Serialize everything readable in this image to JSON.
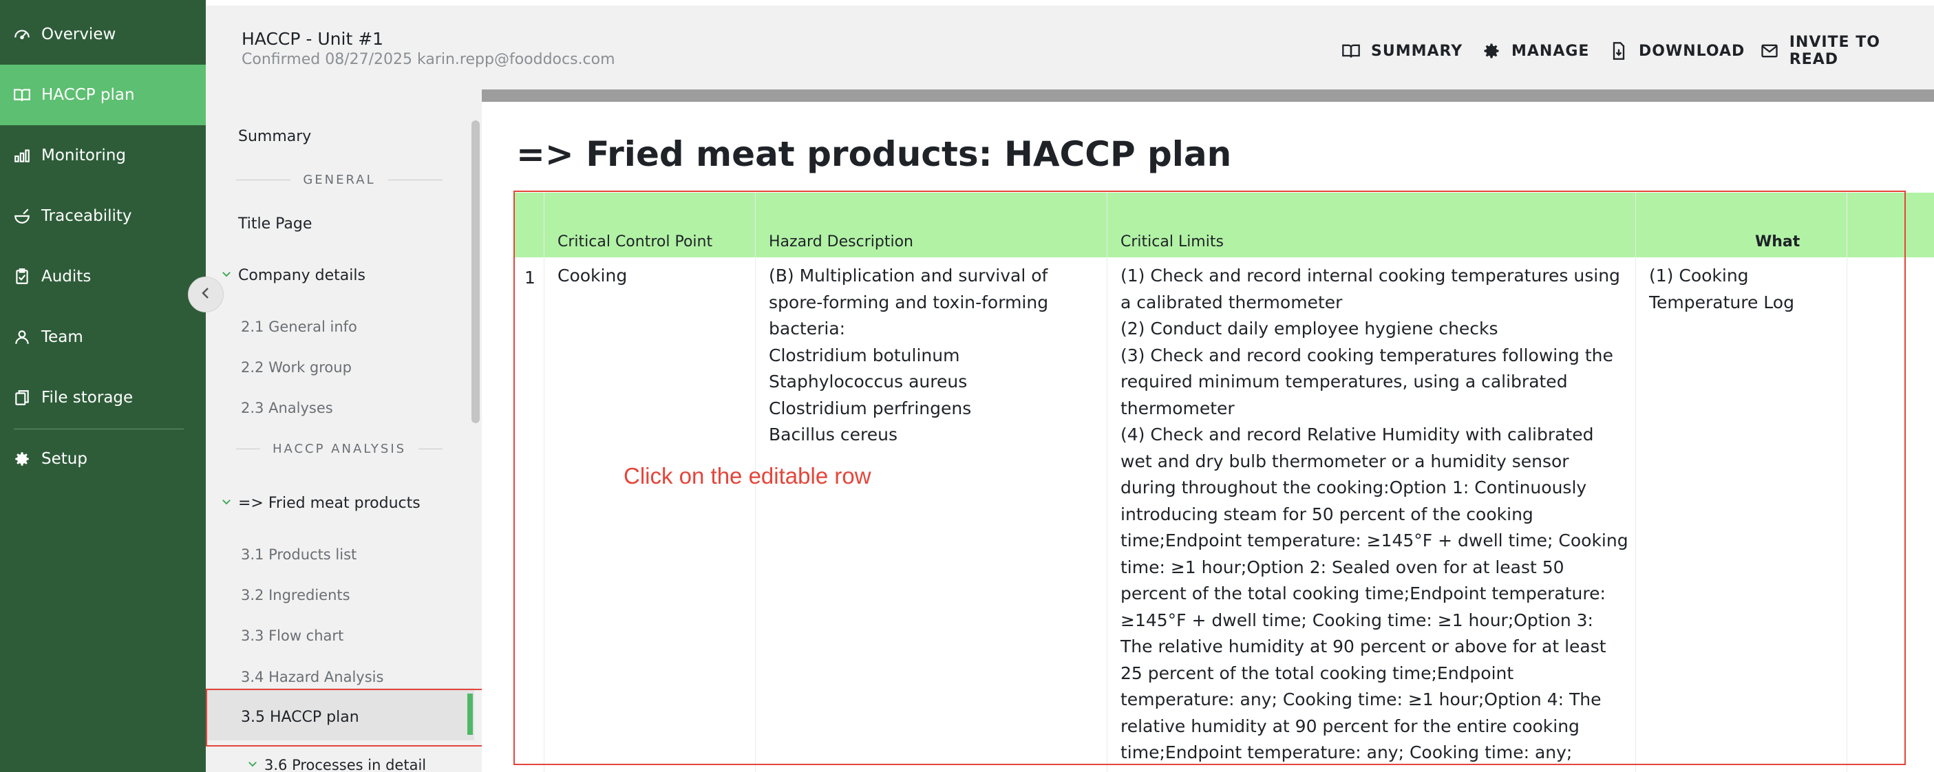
{
  "nav": {
    "items": [
      {
        "label": "Overview",
        "icon": "gauge-icon"
      },
      {
        "label": "HACCP plan",
        "icon": "book-icon"
      },
      {
        "label": "Monitoring",
        "icon": "bar-chart-icon"
      },
      {
        "label": "Traceability",
        "icon": "bowl-icon"
      },
      {
        "label": "Audits",
        "icon": "clipboard-icon"
      },
      {
        "label": "Team",
        "icon": "user-icon"
      },
      {
        "label": "File storage",
        "icon": "file-copy-icon"
      },
      {
        "label": "Setup",
        "icon": "gear-icon"
      }
    ],
    "active": "HACCP plan"
  },
  "header": {
    "title": "HACCP - Unit #1",
    "subtitle": "Confirmed 08/27/2025 karin.repp@fooddocs.com",
    "buttons": {
      "summary": "SUMMARY",
      "manage": "MANAGE",
      "download": "DOWNLOAD",
      "invite": "INVITE TO READ"
    }
  },
  "sidebar": {
    "summary": "Summary",
    "section_general": "GENERAL",
    "title_page": "Title Page",
    "company_details": "Company details",
    "general_info": "2.1 General info",
    "work_group": "2.2 Work group",
    "analyses": "2.3 Analyses",
    "section_haccp": "HACCP ANALYSIS",
    "fried_meat": "=> Fried meat products",
    "products_list": "3.1 Products list",
    "ingredients": "3.2 Ingredients",
    "flow_chart": "3.3 Flow chart",
    "hazard_analysis": "3.4 Hazard Analysis",
    "haccp_plan": "3.5 HACCP plan",
    "processes": "3.6 Processes in detail"
  },
  "main": {
    "title": "=> Fried meat products: HACCP plan",
    "table": {
      "headers": {
        "ccp": "Critical Control Point",
        "hazard": "Hazard Description",
        "limits": "Critical Limits",
        "what": "What"
      },
      "rows": [
        {
          "num": "1",
          "ccp": "Cooking",
          "hazard": "(B) Multiplication and survival of spore-forming and toxin-forming bacteria:\nClostridium botulinum\nStaphylococcus aureus\nClostridium perfringens\nBacillus cereus",
          "limits": "(1) Check and record internal cooking temperatures using a calibrated thermometer\n(2) Conduct daily employee hygiene checks\n(3) Check and record cooking temperatures following the required minimum temperatures, using a calibrated thermometer\n(4) Check and record Relative Humidity with calibrated wet and dry bulb thermometer or a humidity sensor during throughout the cooking:Option 1: Continuously introducing steam for 50 percent of the cooking time;Endpoint temperature: ≥145°F + dwell time; Cooking time: ≥1 hour;Option 2: Sealed oven for at least 50 percent of the total cooking time;Endpoint temperature: ≥145°F + dwell time; Cooking time: ≥1 hour;Option 3: The relative humidity at 90 percent or above for at least 25 percent of the total cooking time;Endpoint temperature: any; Cooking time: ≥1 hour;Option 4: The relative humidity at 90 percent for the entire cooking time;Endpoint temperature: any; Cooking time: any;",
          "what": "(1) Cooking Temperature Log"
        }
      ]
    },
    "hint": "Click on the editable row"
  },
  "colors": {
    "nav_bg": "#2e5c39",
    "nav_active": "#5dbf71",
    "table_header": "#b2f2a5",
    "highlight": "#e4453a"
  }
}
